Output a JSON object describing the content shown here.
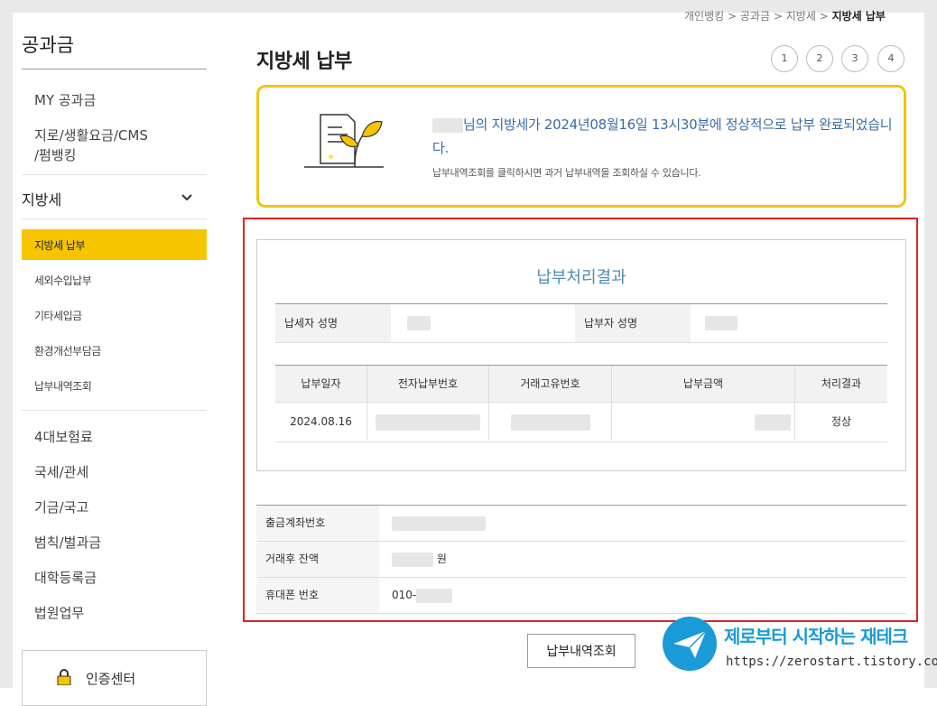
{
  "sidebar": {
    "title": "공과금",
    "items": [
      "MY 공과금",
      "지로/생활요금/CMS",
      "/펌뱅킹"
    ],
    "section": "지방세",
    "sub_items": [
      "지방세 납부",
      "세외수입납부",
      "기타세입금",
      "환경개선부담금",
      "납부내역조회"
    ],
    "lower_items": [
      "4대보험료",
      "국세/관세",
      "기금/국고",
      "범칙/벌과금",
      "대학등록금",
      "법원업무"
    ],
    "cert_label": "인증센터"
  },
  "breadcrumb": [
    "개인뱅킹",
    "공과금",
    "지방세",
    "지방세 납부"
  ],
  "breadcrumb_sep": ">",
  "page_title": "지방세 납부",
  "steps": [
    "1",
    "2",
    "3",
    "4"
  ],
  "notice": {
    "message": "님의 지방세가 2024년08월16일 13시30분에 정상적으로 납부 완료되었습니다.",
    "sub": "납부내역조회를 클릭하시면 과거 납부내역을 조회하실 수 있습니다."
  },
  "result": {
    "title": "납부처리결과",
    "taxpayer_label": "납세자 성명",
    "payer_label": "납부자 성명",
    "columns": [
      "납부일자",
      "전자납부번호",
      "거래고유번호",
      "납부금액",
      "처리결과"
    ],
    "row": {
      "date": "2024.08.16",
      "status": "정상"
    }
  },
  "account": {
    "withdraw_label": "출금계좌번호",
    "balance_label": "거래후 잔액",
    "balance_unit": "원",
    "phone_label": "휴대폰 번호",
    "phone_prefix": "010-"
  },
  "history_button": "납부내역조회",
  "watermark": {
    "title": "제로부터 시작하는 재테크",
    "url": "https://zerostart.tistory.com/"
  },
  "colors": {
    "accent": "#f6c500",
    "link": "#3a6aa5",
    "highlight": "#e0221e",
    "brand": "#1a9ad6"
  }
}
